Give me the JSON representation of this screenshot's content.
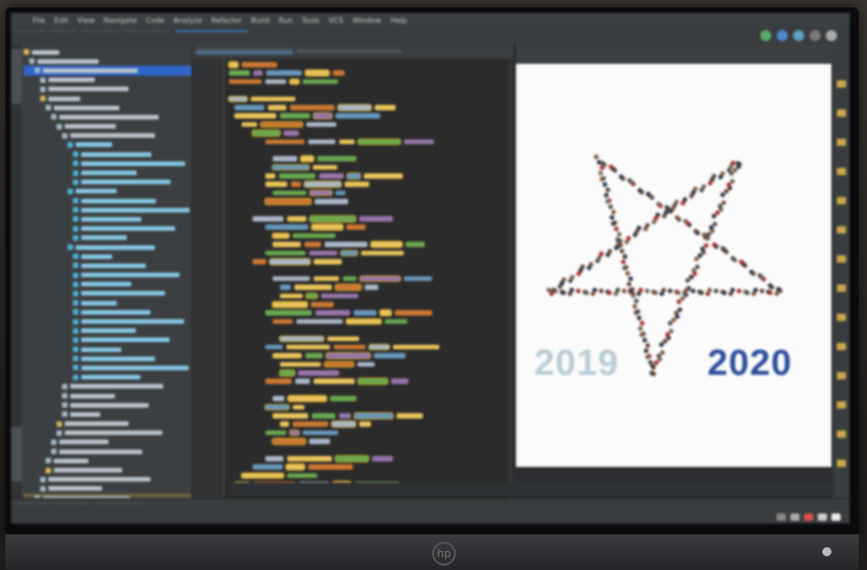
{
  "menu": {
    "items": [
      "File",
      "Edit",
      "View",
      "Navigate",
      "Code",
      "Analyze",
      "Refactor",
      "Build",
      "Run",
      "Tools",
      "VCS",
      "Window",
      "Help"
    ]
  },
  "toolbar": {
    "breadcrumbs": [
      "",
      "",
      "",
      "",
      ""
    ],
    "run_config": ""
  },
  "editor": {
    "tabs": [
      "",
      ""
    ]
  },
  "preview": {
    "year_left": "2019",
    "year_right": "2020",
    "colors": {
      "year_left": "#b8cdd6",
      "year_right": "#2e4f9b",
      "star_people": "#6b4a3a"
    }
  },
  "statusbar": {
    "items": [
      "",
      "",
      ""
    ],
    "message": ""
  },
  "colors": {
    "ide_bg": "#2b2b2b",
    "sidebar_bg": "#3c3f41",
    "tree_highlight": "#2f65ca",
    "token_yellow": "#e8c35a",
    "token_green": "#6aa84f",
    "token_orange": "#cc7832",
    "token_purple": "#9876aa"
  }
}
